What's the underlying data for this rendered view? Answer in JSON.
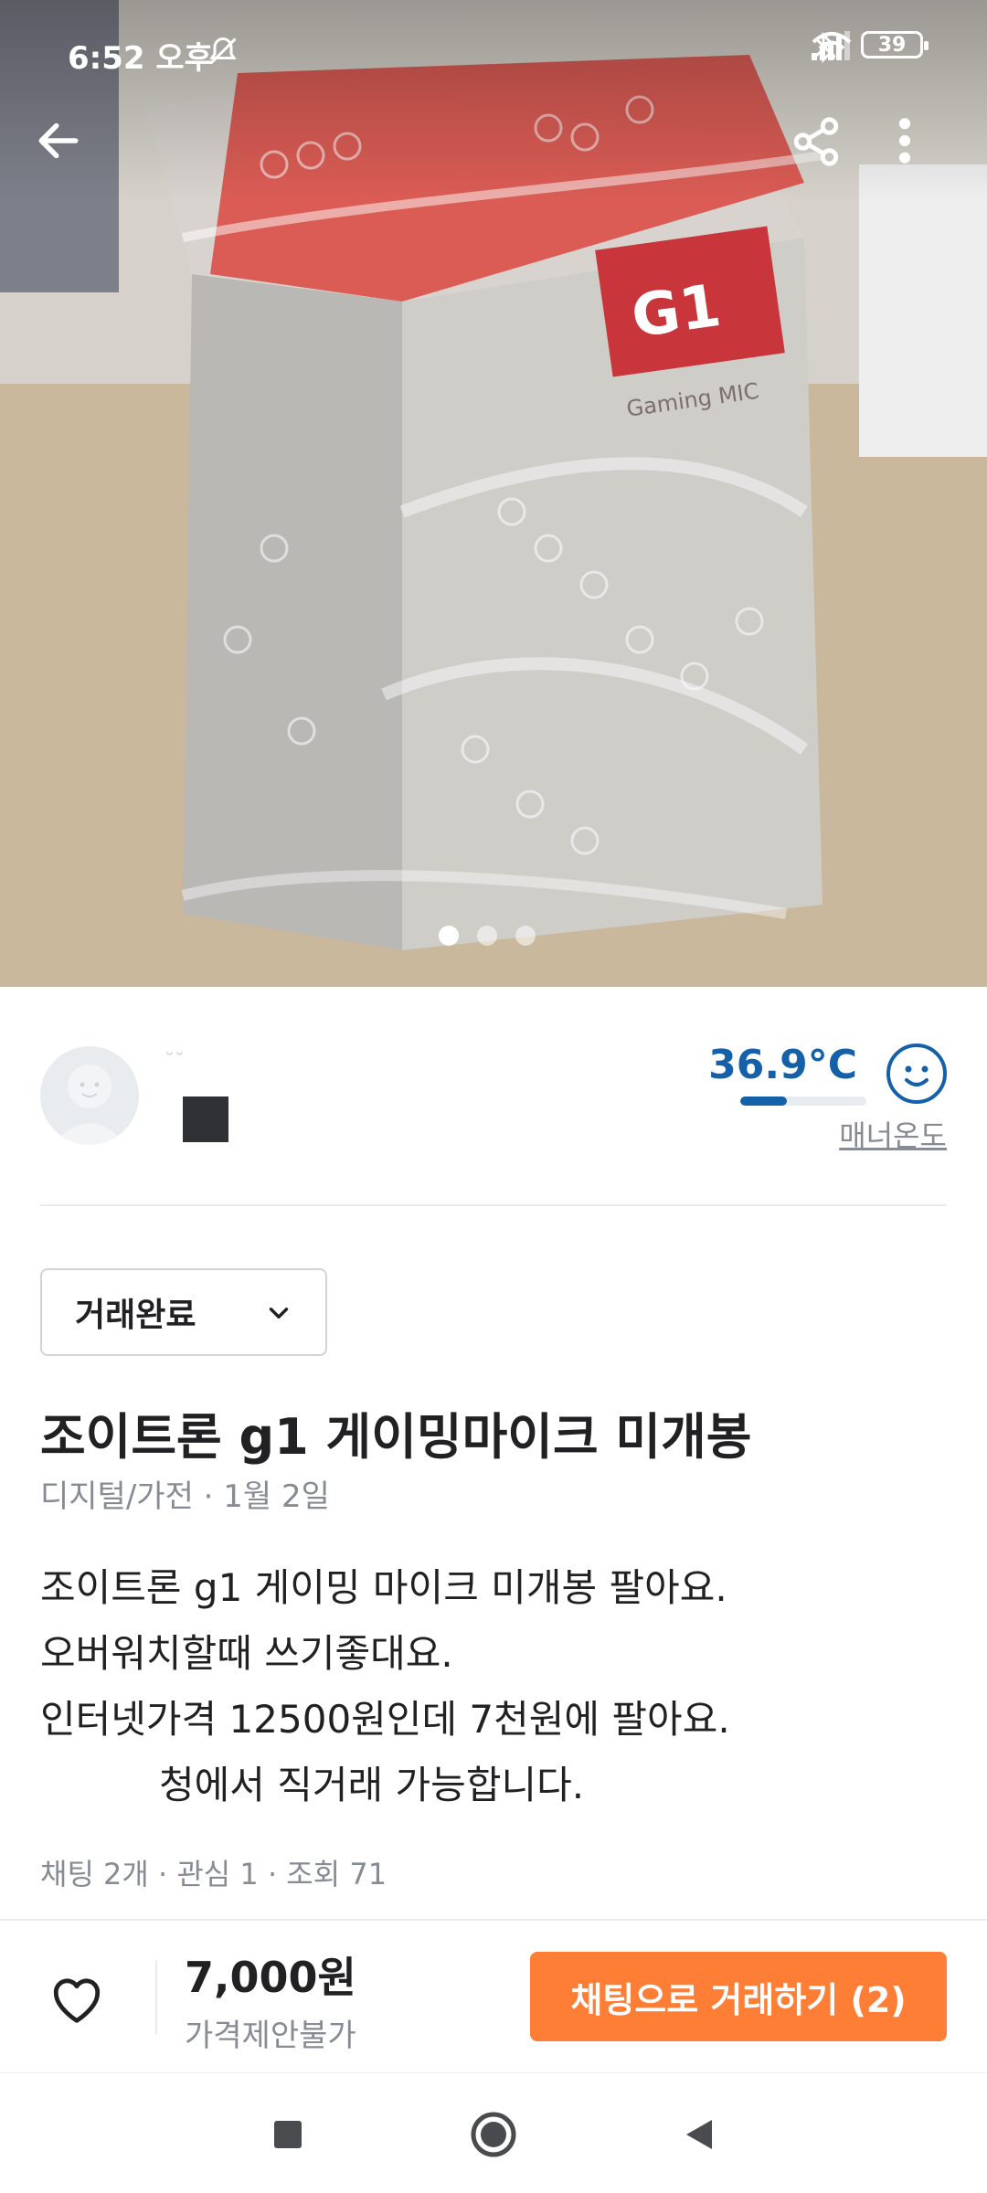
{
  "status_bar": {
    "time": "6:52 오후",
    "battery": "39",
    "icons": [
      "mute-icon",
      "bluetooth-icon",
      "signal-icon",
      "wifi-icon",
      "battery-icon"
    ]
  },
  "top_nav": {
    "icons": [
      "back-arrow-icon",
      "share-icon",
      "more-vert-icon"
    ]
  },
  "gallery": {
    "page_count": 3,
    "active_index": 0
  },
  "seller": {
    "nickname": "˘˘",
    "temperature": "36.9°C",
    "temperature_fraction": 0.369,
    "manner_label": "매너온도",
    "colors": {
      "temperature": "#1561a9"
    }
  },
  "product": {
    "status_select": "거래완료",
    "title": "조이트론 g1 게이밍마이크 미개봉",
    "meta": "디지털/가전 · 1월 2일",
    "description": [
      "조이트론 g1 게이밍 마이크 미개봉 팔아요.",
      "오버워치할때 쓰기좋대요.",
      "인터넷가격 12500원인데 7천원에 팔아요.",
      "청에서 직거래 가능합니다."
    ],
    "stats": "채팅 2개 · 관심 1 · 조회 71"
  },
  "action_bar": {
    "price": "7,000원",
    "negotiate": "가격제안불가",
    "chat_button": "채팅으로 거래하기 (2)",
    "colors": {
      "accent": "#ff7e36"
    }
  },
  "system_nav": {
    "icons": [
      "recents-square-icon",
      "home-circle-icon",
      "back-triangle-icon"
    ]
  }
}
